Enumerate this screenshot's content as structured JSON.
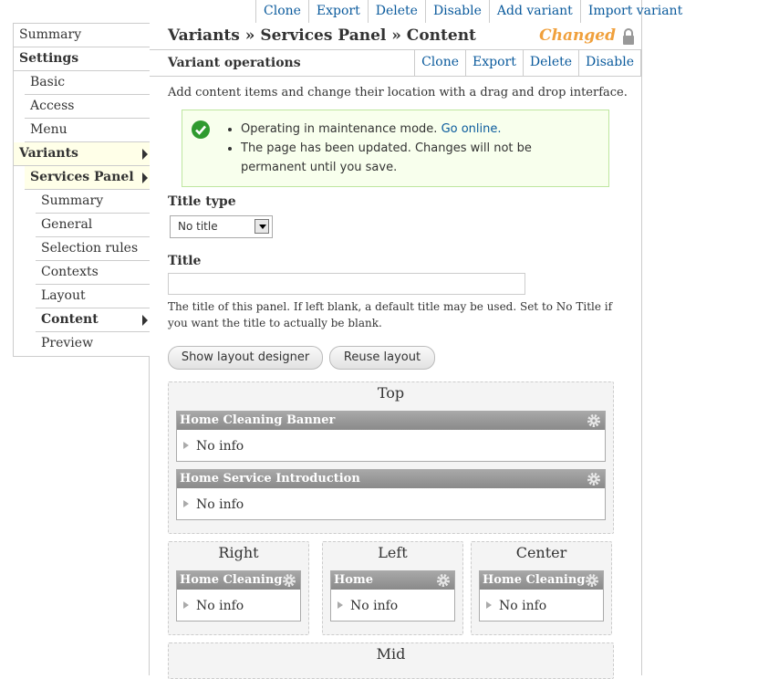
{
  "top_actions": [
    "Clone",
    "Export",
    "Delete",
    "Disable",
    "Add variant",
    "Import variant"
  ],
  "sidebar": {
    "items": [
      {
        "label": "Summary"
      },
      {
        "label": "Settings"
      },
      {
        "label": "Basic"
      },
      {
        "label": "Access"
      },
      {
        "label": "Menu"
      },
      {
        "label": "Variants"
      },
      {
        "label": "Services Panel"
      },
      {
        "label": "Summary"
      },
      {
        "label": "General"
      },
      {
        "label": "Selection rules"
      },
      {
        "label": "Contexts"
      },
      {
        "label": "Layout"
      },
      {
        "label": "Content"
      },
      {
        "label": "Preview"
      }
    ]
  },
  "header": {
    "title": "Variants » Services Panel » Content",
    "changed": "Changed",
    "lock_icon": "lock-icon"
  },
  "operations": {
    "title": "Variant operations",
    "tabs": [
      "Clone",
      "Export",
      "Delete",
      "Disable"
    ]
  },
  "intro": "Add content items and change their location with a drag and drop interface.",
  "messages": {
    "icon": "check-icon",
    "status_color": "#2f9a2f",
    "line1_text": "Operating in maintenance mode.",
    "line1_link": "Go online.",
    "line2": "The page has been updated. Changes will not be permanent until you save."
  },
  "form": {
    "title_type_label": "Title type",
    "title_type_value": "No title",
    "title_label": "Title",
    "title_value": "",
    "title_description": "The title of this panel. If left blank, a default title may be used. Set to No Title if you want the title to actually be blank."
  },
  "buttons": {
    "show_layout_designer": "Show layout designer",
    "reuse_layout": "Reuse layout"
  },
  "regions": {
    "top": {
      "title": "Top",
      "panes": [
        {
          "title": "Home Cleaning Banner",
          "body": "No info"
        },
        {
          "title": "Home Service Introduction",
          "body": "No info"
        }
      ]
    },
    "right": {
      "title": "Right",
      "panes": [
        {
          "title": "Home Cleaning",
          "body": "No info"
        }
      ]
    },
    "left": {
      "title": "Left",
      "panes": [
        {
          "title": "Home",
          "body": "No info"
        }
      ]
    },
    "center": {
      "title": "Center",
      "panes": [
        {
          "title": "Home Cleaning",
          "body": "No info"
        }
      ]
    },
    "mid": {
      "title": "Mid"
    }
  },
  "colors": {
    "link": "#0a5a9c",
    "changed": "#f0a03c",
    "message_bg": "#f8ffed",
    "pane_header": "#999999"
  }
}
